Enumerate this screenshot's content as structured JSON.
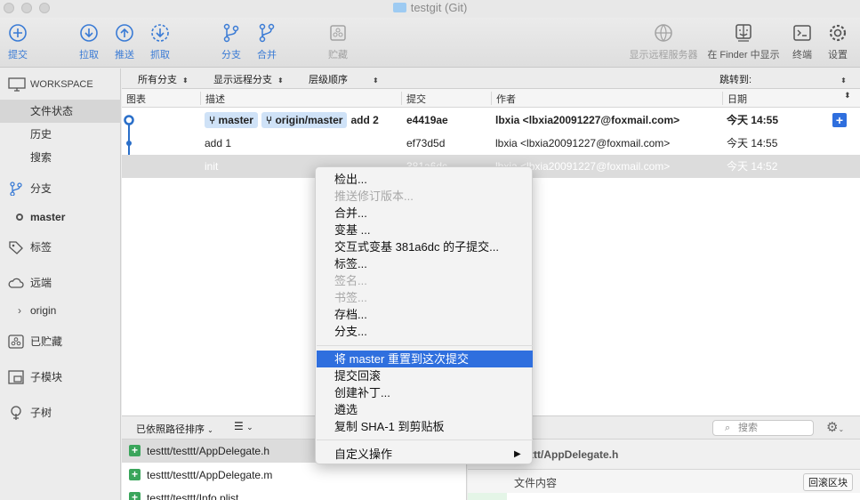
{
  "window": {
    "title": "testgit (Git)"
  },
  "toolbar": {
    "commit": "提交",
    "pull": "拉取",
    "push": "推送",
    "fetch": "抓取",
    "branch": "分支",
    "merge": "合并",
    "stash": "贮藏",
    "remote": "显示远程服务器",
    "finder": "在 Finder 中显示",
    "terminal": "终端",
    "settings": "设置"
  },
  "sidebar": {
    "workspace": "WORKSPACE",
    "file_status": "文件状态",
    "history": "历史",
    "search": "搜索",
    "branches": "分支",
    "master": "master",
    "tags": "标签",
    "remotes": "远端",
    "origin": "origin",
    "stashes": "已贮藏",
    "submodules": "子模块",
    "subtrees": "子树"
  },
  "filterbar": {
    "all_branches": "所有分支",
    "show_remote": "显示远程分支",
    "order": "层级顺序",
    "jump": "跳转到:"
  },
  "columns": {
    "graph": "图表",
    "description": "描述",
    "commit": "提交",
    "author": "作者",
    "date": "日期"
  },
  "commits": [
    {
      "branch_tag": "master",
      "remote_tag": "origin/master",
      "message": "add 2",
      "hash": "e4419ae",
      "author": "lbxia <lbxia20091227@foxmail.com>",
      "date": "今天 14:55"
    },
    {
      "message": "add 1",
      "hash": "ef73d5d",
      "author": "lbxia <lbxia20091227@foxmail.com>",
      "date": "今天 14:55"
    },
    {
      "message": "init",
      "hash": "381a6dc",
      "author": "lbxia <lbxia20091227@foxmail.com>",
      "date": "今天 14:52"
    }
  ],
  "bottombar": {
    "sort": "已依照路径排序",
    "search_placeholder": "搜索"
  },
  "files": [
    {
      "path": "testtt/testtt/AppDelegate.h"
    },
    {
      "path": "testtt/testtt/AppDelegate.m"
    },
    {
      "path": "testtt/testtt/Info.plist"
    }
  ],
  "diff": {
    "file": "ttt/AppDelegate.h",
    "content_label": "文件内容",
    "revert_hunk": "回滚区块"
  },
  "context_menu": {
    "items": [
      {
        "label": "检出...",
        "enabled": true
      },
      {
        "label": "推送修订版本...",
        "enabled": false
      },
      {
        "label": "合并...",
        "enabled": true
      },
      {
        "label": "变基 ...",
        "enabled": true
      },
      {
        "label": "交互式变基 381a6dc 的子提交...",
        "enabled": true
      },
      {
        "label": "标签...",
        "enabled": true
      },
      {
        "label": "签名...",
        "enabled": false
      },
      {
        "label": "书签...",
        "enabled": false
      },
      {
        "label": "存档...",
        "enabled": true
      },
      {
        "label": "分支...",
        "enabled": true
      }
    ],
    "items2": [
      {
        "label": "将 master 重置到这次提交",
        "highlighted": true
      },
      {
        "label": "提交回滚"
      },
      {
        "label": "创建补丁..."
      },
      {
        "label": "遴选"
      },
      {
        "label": "复制 SHA-1 到剪贴板"
      }
    ],
    "custom": "自定义操作"
  },
  "colors": {
    "accent": "#2f6fde",
    "selection_row": "#dcdcdc",
    "tag_bg": "#cfe2f7",
    "added": "#3aa55b"
  }
}
